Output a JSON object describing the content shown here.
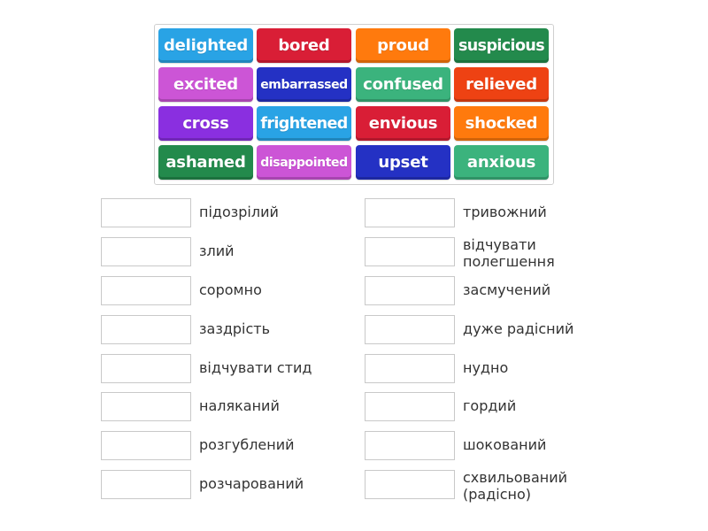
{
  "word_bank": {
    "tiles": [
      {
        "label": "delighted",
        "color": "#29a3e5"
      },
      {
        "label": "bored",
        "color": "#d91e36"
      },
      {
        "label": "proud",
        "color": "#ff7a0d"
      },
      {
        "label": "suspicious",
        "color": "#238a4c"
      },
      {
        "label": "excited",
        "color": "#cc55d6"
      },
      {
        "label": "embarrassed",
        "color": "#2431c4"
      },
      {
        "label": "confused",
        "color": "#3bb37d"
      },
      {
        "label": "relieved",
        "color": "#ee4213"
      },
      {
        "label": "cross",
        "color": "#8a2fe0"
      },
      {
        "label": "frightened",
        "color": "#29a3e5"
      },
      {
        "label": "envious",
        "color": "#d91e36"
      },
      {
        "label": "shocked",
        "color": "#ff7a0d"
      },
      {
        "label": "ashamed",
        "color": "#238a4c"
      },
      {
        "label": "disappointed",
        "color": "#cc55d6"
      },
      {
        "label": "upset",
        "color": "#2431c4"
      },
      {
        "label": "anxious",
        "color": "#3bb37d"
      }
    ]
  },
  "targets": {
    "left": [
      {
        "label": "підозрілий",
        "value": ""
      },
      {
        "label": "злий",
        "value": ""
      },
      {
        "label": "соромно",
        "value": ""
      },
      {
        "label": "заздрість",
        "value": ""
      },
      {
        "label": "відчувати стид",
        "value": ""
      },
      {
        "label": "наляканий",
        "value": ""
      },
      {
        "label": "розгублений",
        "value": ""
      },
      {
        "label": "розчарований",
        "value": ""
      }
    ],
    "right": [
      {
        "label": "тривожний",
        "value": ""
      },
      {
        "label": "відчувати полегшення",
        "value": ""
      },
      {
        "label": "засмучений",
        "value": ""
      },
      {
        "label": "дуже радісний",
        "value": ""
      },
      {
        "label": "нудно",
        "value": ""
      },
      {
        "label": "гордий",
        "value": ""
      },
      {
        "label": "шокований",
        "value": ""
      },
      {
        "label": "схвильований (радісно)",
        "value": ""
      }
    ]
  }
}
